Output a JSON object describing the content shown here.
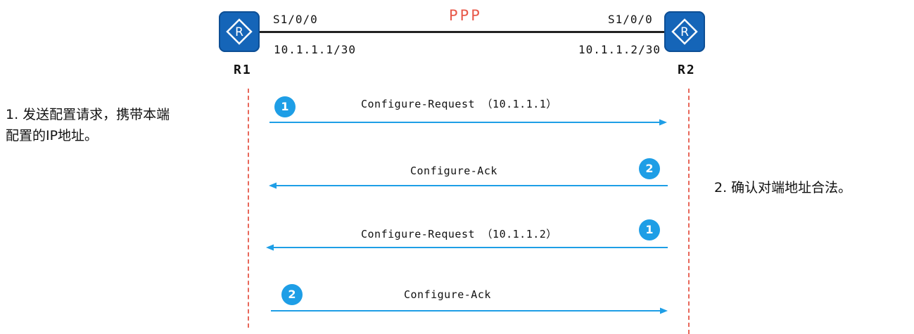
{
  "topology": {
    "protocol": "PPP",
    "r1": {
      "name": "R1",
      "interface": "S1/0/0",
      "ip": "10.1.1.1/30",
      "icon_letter": "R"
    },
    "r2": {
      "name": "R2",
      "interface": "S1/0/0",
      "ip": "10.1.1.2/30",
      "icon_letter": "R"
    }
  },
  "messages": [
    {
      "label": "Configure-Request （10.1.1.1）",
      "badge": "1",
      "direction": "right"
    },
    {
      "label": "Configure-Ack",
      "badge": "2",
      "direction": "left"
    },
    {
      "label": "Configure-Request （10.1.1.2）",
      "badge": "1",
      "direction": "left"
    },
    {
      "label": "Configure-Ack",
      "badge": "2",
      "direction": "right"
    }
  ],
  "notes": {
    "left_line1": "1. 发送配置请求，携带本端",
    "left_line2": "配置的IP地址。",
    "right": "2. 确认对端地址合法。"
  },
  "colors": {
    "router": "#1565b8",
    "link": "#222222",
    "protocol_text": "#e8594a",
    "timeline": "#e8675a",
    "arrow": "#1e9ee6",
    "badge": "#1e9ee6"
  }
}
